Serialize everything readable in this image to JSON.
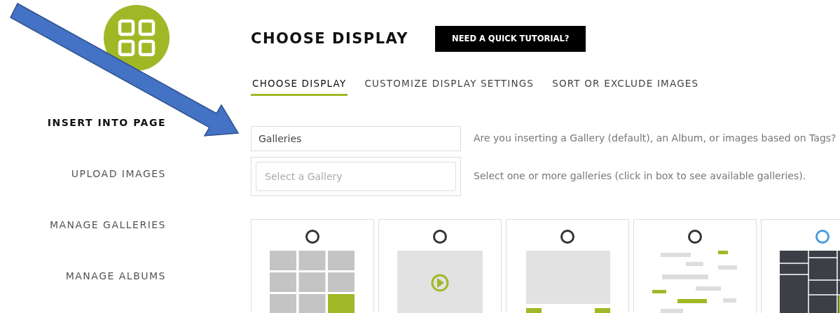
{
  "sidebar": {
    "items": [
      {
        "label": "INSERT INTO PAGE",
        "selected": true
      },
      {
        "label": "UPLOAD IMAGES",
        "selected": false
      },
      {
        "label": "MANAGE GALLERIES",
        "selected": false
      },
      {
        "label": "MANAGE ALBUMS",
        "selected": false
      }
    ]
  },
  "header": {
    "title": "CHOOSE DISPLAY",
    "tutorial_button": "NEED A QUICK TUTORIAL?"
  },
  "tabs": [
    {
      "label": "CHOOSE DISPLAY",
      "selected": true
    },
    {
      "label": "CUSTOMIZE DISPLAY SETTINGS",
      "selected": false
    },
    {
      "label": "SORT OR EXCLUDE IMAGES",
      "selected": false
    }
  ],
  "form": [
    {
      "kind": "select",
      "value": "Galleries",
      "help": "Are you inserting a Gallery (default), an Album, or images based on Tags?"
    },
    {
      "kind": "tags",
      "placeholder": "Select a Gallery",
      "help": "Select one or more galleries (click in box to see available galleries)."
    }
  ],
  "displays": [
    {
      "kind": "grid",
      "color": "#333333"
    },
    {
      "kind": "video",
      "color": "#333333"
    },
    {
      "kind": "slideshow",
      "color": "#333333"
    },
    {
      "kind": "cloud",
      "color": "#333333"
    },
    {
      "kind": "mosaic",
      "color": "#4a9be0"
    }
  ]
}
